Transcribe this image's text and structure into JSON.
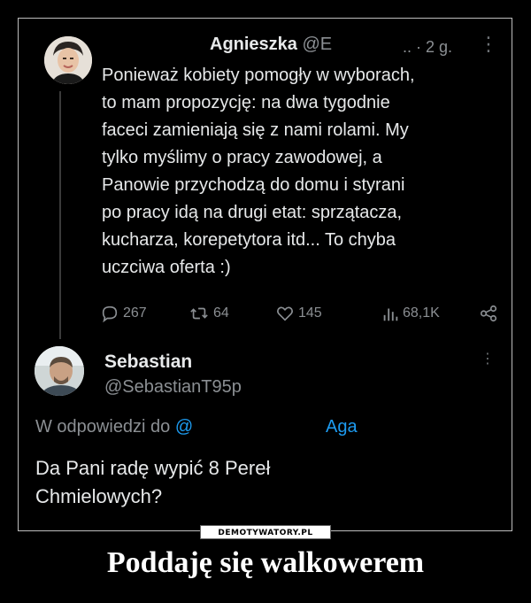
{
  "tweet": {
    "author_name": "Agnieszka",
    "author_handle": "@E",
    "dots": "..",
    "time": "· 2 g.",
    "more": "⋮",
    "body_lines": [
      "Ponieważ kobiety pomogły w wyborach,",
      "to mam propozycję: na dwa tygodnie",
      "faceci zamieniają się z nami rolami. My",
      "tylko myślimy o pracy zawodowej, a",
      "Panowie przychodzą do domu i styrani",
      "po pracy idą na drugi etat: sprzątacza,",
      "kucharza, korepetytora itd... To chyba",
      "uczciwa oferta :)"
    ],
    "stats": {
      "replies": "267",
      "retweets": "64",
      "likes": "145",
      "views": "68,1K"
    },
    "icons": [
      "reply-icon",
      "retweet-icon",
      "like-icon",
      "views-icon",
      "share-icon"
    ]
  },
  "reply": {
    "author_name": "Sebastian",
    "author_handle": "@SebastianT95p",
    "more": "⋮",
    "replying_prefix": "W odpowiedzi do",
    "replying_mention": "@",
    "replying_name": "Aga",
    "body_lines": [
      "Da Pani radę wypić 8 Pereł",
      "Chmielowych?"
    ]
  },
  "watermark": "DEMOTYWATORY.PL",
  "caption": "Poddaję się walkowerem",
  "colors": {
    "background": "#000000",
    "text": "#e7e9ea",
    "muted": "#8b8f93",
    "link": "#1d9bf0"
  }
}
